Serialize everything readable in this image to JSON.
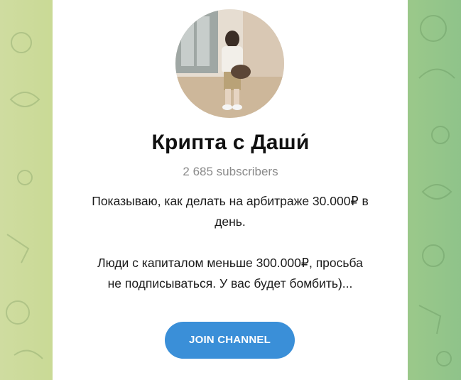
{
  "channel": {
    "name": "Крипта с Даши́",
    "subscribers": "2 685 subscribers",
    "description_lines": [
      "Показываю, как делать на арбитраже 30.000₽ в",
      "день.",
      "Люди с капиталом меньше 300.000₽, просьба",
      "не подписываться. У вас будет бомбить)..."
    ]
  },
  "actions": {
    "join_label": "JOIN CHANNEL"
  },
  "colors": {
    "accent": "#3a8fd8",
    "card": "#ffffff",
    "background_left": "#cfdca0",
    "background_right": "#8fc38a"
  },
  "icons": {
    "avatar": "channel-avatar-photo"
  }
}
